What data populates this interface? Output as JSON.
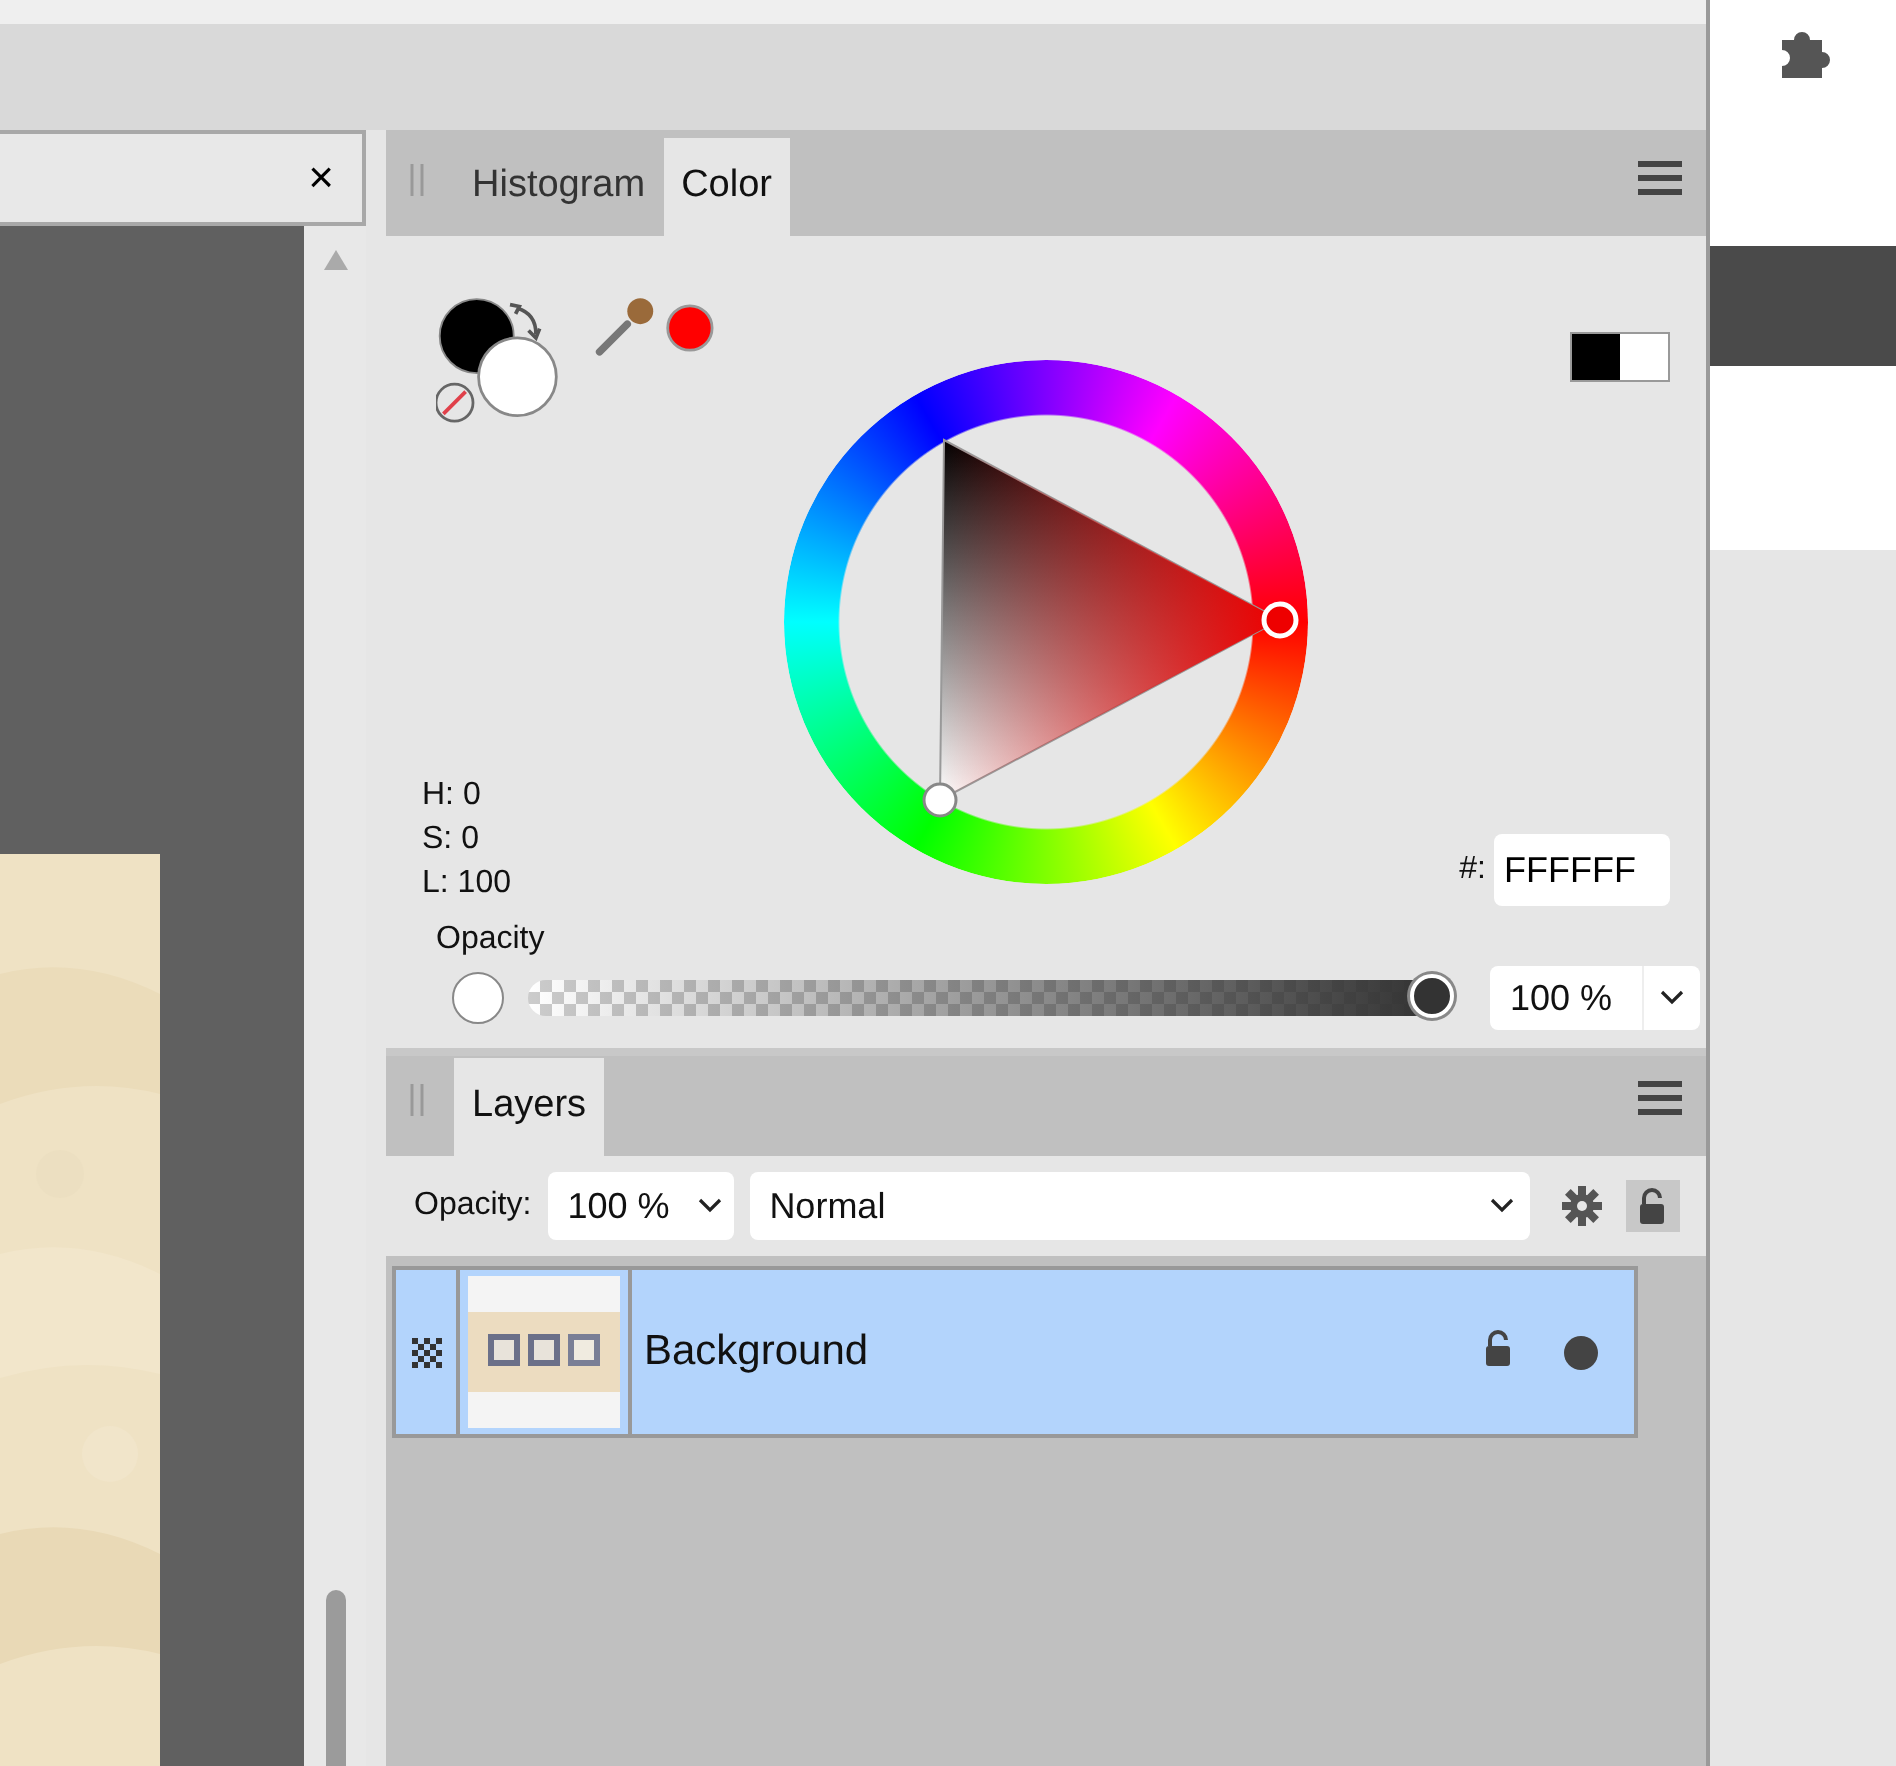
{
  "document_tab": {
    "close": "×"
  },
  "color_panel": {
    "tabs": [
      {
        "label": "Histogram",
        "selected": false
      },
      {
        "label": "Color",
        "selected": true
      }
    ],
    "swatches": [
      {
        "kind": "fill",
        "color": "#000000"
      },
      {
        "kind": "stroke",
        "color": "#ffffff"
      }
    ],
    "picker": {
      "color": "#ff0000"
    },
    "readouts": [
      "H: 0",
      "S: 0",
      "L: 100"
    ],
    "hex": {
      "label": "#:",
      "value": "FFFFFF"
    },
    "opacity": {
      "label": "Opacity",
      "level": 1,
      "reading": "100 %"
    }
  },
  "layers_panel": {
    "tabs": [
      {
        "label": "Layers",
        "selected": true
      }
    ],
    "toolbar": {
      "opacity_label": "Opacity:",
      "opacity_value": "100 %",
      "blend_mode": "Normal"
    },
    "layers": [
      {
        "name": "Background",
        "selected": true
      }
    ]
  }
}
